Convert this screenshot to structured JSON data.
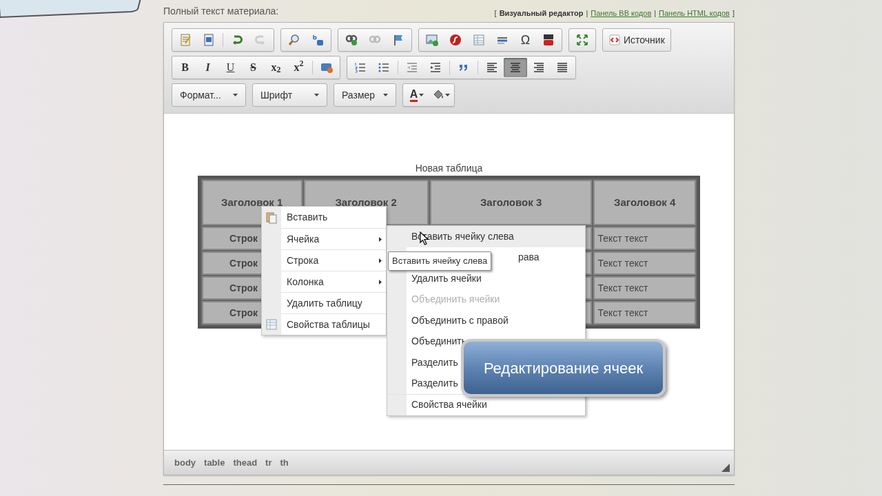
{
  "field_label": "Полный текст материала:",
  "mode_switch": {
    "open": "[",
    "close": "]",
    "separator": "|",
    "modes": [
      {
        "label": "Визуальный редактор",
        "selected": true
      },
      {
        "label": "Панель BB кодов",
        "selected": false
      },
      {
        "label": "Панель HTML кодов",
        "selected": false
      }
    ]
  },
  "toolbar": {
    "rows": [
      [
        [
          {
            "kind": "icon",
            "selected": false
          },
          {
            "kind": "icon",
            "selected": false
          },
          {
            "kind": "icon",
            "selected": false
          },
          {
            "kind": "icon",
            "selected": false
          }
        ],
        [
          {
            "kind": "icon",
            "selected": false
          },
          {
            "kind": "icon",
            "selected": false
          }
        ],
        [
          {
            "kind": "icon",
            "selected": false
          },
          {
            "kind": "icon",
            "selected": false
          },
          {
            "kind": "icon",
            "selected": false
          }
        ],
        [
          {
            "kind": "icon",
            "selected": false
          },
          {
            "kind": "icon",
            "selected": false
          },
          {
            "kind": "icon",
            "selected": false
          },
          {
            "kind": "icon",
            "selected": false
          },
          {
            "kind": "glyph",
            "label": "Ω",
            "selected": false
          },
          {
            "kind": "icon",
            "selected": false
          }
        ],
        [
          {
            "kind": "icon",
            "selected": false
          }
        ],
        [
          {
            "kind": "source",
            "label": "Источник",
            "selected": false
          }
        ]
      ],
      [
        [
          {
            "kind": "glyph",
            "label": "B",
            "selected": false
          },
          {
            "kind": "glyph",
            "label": "I",
            "selected": false
          },
          {
            "kind": "glyph",
            "label": "U",
            "selected": false
          },
          {
            "kind": "glyph",
            "label": "S",
            "selected": false
          },
          {
            "kind": "glyph",
            "label": "x$_{2}$",
            "selected": false
          },
          {
            "kind": "glyph",
            "label": "x$^{2}$",
            "selected": false
          },
          {
            "kind": "icon",
            "selected": false
          }
        ],
        [
          {
            "kind": "icon",
            "selected": false
          },
          {
            "kind": "icon",
            "selected": false
          },
          {
            "kind": "icon",
            "selected": false
          },
          {
            "kind": "icon",
            "selected": false
          },
          {
            "kind": "icon",
            "selected": false
          },
          {
            "kind": "icon",
            "selected": false
          },
          {
            "kind": "icon",
            "selected": true
          },
          {
            "kind": "icon",
            "selected": false
          },
          {
            "kind": "icon",
            "selected": false
          }
        ]
      ],
      [
        [
          {
            "kind": "dropdown",
            "label": "Формат...",
            "selected": false
          }
        ],
        [
          {
            "kind": "dropdown",
            "label": "Шрифт",
            "selected": false
          }
        ],
        [
          {
            "kind": "dropdown",
            "label": "Размер",
            "selected": false
          }
        ],
        [
          {
            "kind": "color",
            "label": "A",
            "selected": false
          },
          {
            "kind": "icon",
            "selected": false
          }
        ]
      ]
    ]
  },
  "table": {
    "caption": "Новая таблица",
    "headers": [
      "Заголовок 1",
      "Заголовок 2",
      "Заголовок 3",
      "Заголовок 4"
    ],
    "rows": [
      {
        "column_1": "Строк",
        "column_4": "Текст текст"
      },
      {
        "column_1": "Строк",
        "column_4": "Текст текст"
      },
      {
        "column_1": "Строк",
        "column_4": "Текст текст"
      },
      {
        "column_1": "Строк",
        "column_4": "Текст текст"
      }
    ]
  },
  "context_menu": {
    "items": [
      {
        "label": "Вставить",
        "kind": "paste"
      },
      {
        "label": "Ячейка",
        "kind": "submenu"
      },
      {
        "label": "Строка",
        "kind": "submenu"
      },
      {
        "label": "Колонка",
        "kind": "submenu"
      },
      {
        "label": "Удалить таблицу",
        "kind": "plain"
      },
      {
        "label": "Свойства таблицы",
        "kind": "properties"
      }
    ]
  },
  "submenu": {
    "items": [
      {
        "label": "Вставить ячейку слева",
        "kind": "plain",
        "highlighted": true,
        "disabled": false
      },
      {
        "label": "рава",
        "kind": "partial",
        "highlighted": false,
        "disabled": false
      },
      {
        "label": "Удалить ячейки",
        "kind": "plain",
        "highlighted": false,
        "disabled": false
      },
      {
        "label": "Объединить ячейки",
        "kind": "plain",
        "highlighted": false,
        "disabled": true
      },
      {
        "label": "Объединить с правой",
        "kind": "plain",
        "highlighted": false,
        "disabled": false
      },
      {
        "label": "Объединить",
        "kind": "plain",
        "highlighted": false,
        "disabled": false
      },
      {
        "label": "Разделить",
        "kind": "plain",
        "highlighted": false,
        "disabled": false
      },
      {
        "label": "Разделить",
        "kind": "plain",
        "highlighted": false,
        "disabled": false
      },
      {
        "label": "Свойства ячейки",
        "kind": "separated",
        "highlighted": false,
        "disabled": false
      }
    ]
  },
  "tooltip": "Вставить ячейку слева",
  "callout": "Редактирование ячеек",
  "element_path": [
    "body",
    "table",
    "thead",
    "tr",
    "th"
  ]
}
